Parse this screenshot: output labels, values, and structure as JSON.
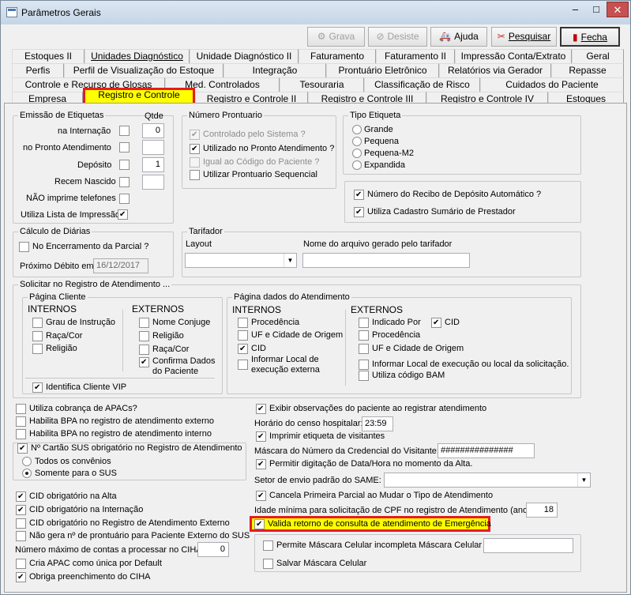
{
  "window": {
    "title": "Parâmetros Gerais",
    "minimize": "–",
    "maximize": "□",
    "close": "✕"
  },
  "toolbar": {
    "grava": "Grava",
    "desiste": "Desiste",
    "ajuda": "Ajuda",
    "pesquisar": "Pesquisar",
    "fecha": "Fecha"
  },
  "tabs": {
    "row1": [
      "Estoques II",
      "Unidades Diagnóstico",
      "Unidade Diagnóstico II",
      "Faturamento",
      "Faturamento II",
      "Impressão Conta/Extrato",
      "Geral"
    ],
    "row2": [
      "Perfis",
      "Perfil de Visualização do Estoque",
      "Integração",
      "Prontuário Eletrônico",
      "Relatórios via Gerador",
      "Repasse"
    ],
    "row3": [
      "Controle e Recurso de Glosas",
      "Med. Controlados",
      "Tesouraria",
      "Classificação de Risco",
      "Cuidados do Paciente"
    ],
    "row4": [
      "Empresa",
      "Registro e Controle",
      "Registro e Controle II",
      "Registro e Controle III",
      "Registro e Controle IV",
      "Estoques"
    ]
  },
  "emissao": {
    "legend": "Emissão de Etiquetas",
    "qtde": "Qtde",
    "internacao": "na Internação",
    "pronto": "no Pronto Atendimento",
    "deposito": "Depósito",
    "recem": "Recem Nascido",
    "nao_imprime": "NÃO imprime telefones",
    "lista": "Utiliza Lista de Impressão",
    "qtde_internacao": "0",
    "qtde_deposito": "1"
  },
  "numero_prontuario": {
    "legend": "Número Prontuario",
    "controlado": "Controlado pelo Sistema ?",
    "utilizado": "Utilizado no Pronto Atendimento ?",
    "igual": "Igual ao Código do Paciente ?",
    "sequencial": "Utilizar Prontuario Sequencial"
  },
  "tipo_etiqueta": {
    "legend": "Tipo Etiqueta",
    "options": [
      "Grande",
      "Pequena",
      "Pequena-M2",
      "Expandida"
    ]
  },
  "recibo": {
    "numero": "Número do Recibo de Depósito Automático ?",
    "cadastro": "Utiliza Cadastro Sumário de Prestador"
  },
  "calculo": {
    "legend": "Cálculo de Diárias",
    "encerramento": "No Encerramento da Parcial ?",
    "proximo": "Próximo Débito em",
    "data": "16/12/2017"
  },
  "tarifador": {
    "legend": "Tarifador",
    "layout": "Layout",
    "nome": "Nome do arquivo gerado pelo tarifador"
  },
  "solicitar": {
    "legend": "Solicitar no Registro de Atendimento ...",
    "cliente": {
      "legend": "Página Cliente",
      "internos": "INTERNOS",
      "externos": "EXTERNOS",
      "grau": "Grau de Instrução",
      "raca": "Raça/Cor",
      "religiao": "Religião",
      "nome_conjuge": "Nome Conjuge",
      "religiao_ext": "Religião",
      "raca_ext": "Raça/Cor",
      "confirma1": "Confirma Dados",
      "confirma2": "do Paciente",
      "vip": "Identifica Cliente VIP"
    },
    "atendimento": {
      "legend": "Página dados do Atendimento",
      "internos": "INTERNOS",
      "externos": "EXTERNOS",
      "procedencia": "Procedência",
      "uf": "UF e Cidade de Origem",
      "cid": "CID",
      "informar1": "Informar Local de",
      "informar2": "execução externa",
      "indicado": "Indicado Por",
      "cid_ext": "CID",
      "procedencia_ext": "Procedência",
      "uf_ext": "UF e Cidade de Origem",
      "informar_ext": "Informar Local de execução ou local da solicitação.",
      "bam": "Utiliza código BAM"
    }
  },
  "left": {
    "apacs": "Utiliza cobrança de APACs?",
    "bpa_ext": "Habilita BPA no registro de atendimento externo",
    "bpa_int": "Habilita BPA no registro de atendimento interno",
    "cartao_sus": "Nº Cartão SUS obrigatório no Registro de Atendimento",
    "todos": "Todos os convênios",
    "somente": "Somente para o SUS",
    "cid_alta": "CID obrigatório na Alta",
    "cid_int": "CID obrigatório na Internação",
    "cid_ext": "CID obrigatório no Registro de Atendimento Externo",
    "nao_gera": "Não gera nº de prontuário para Paciente Externo do SUS",
    "max_contas": "Número máximo de contas a processar no CIHA:",
    "max_val": "0",
    "cria_apac": "Cria APAC como única por Default",
    "obriga_ciha": "Obriga preenchimento do CIHA"
  },
  "right": {
    "exibir": "Exibir observações do paciente ao registrar atendimento",
    "horario": "Horário do censo hospitalar:",
    "horario_val": "23:59",
    "imprimir": "Imprimir etiqueta de visitantes",
    "mascara": "Máscara do Número da Credencial do Visitante:",
    "mascara_val": "###############",
    "permitir": "Permitir digitação de Data/Hora no momento da Alta.",
    "setor": "Setor de envio padrão do SAME:",
    "cancela": "Cancela Primeira Parcial ao Mudar o Tipo de Atendimento",
    "idade": "Idade mínima para solicitação de CPF no registro de Atendimento (anos):",
    "idade_val": "18",
    "valida": "Valida retorno de consulta de atendimento de Emergência",
    "permite_mascara": "Permite Máscara Celular incompleta",
    "mascara_celular": "Máscara Celular",
    "salvar": "Salvar Máscara Celular"
  },
  "colors": {
    "highlight": "#ffff00",
    "highlight_border": "#e51b24",
    "close": "#c75050"
  }
}
